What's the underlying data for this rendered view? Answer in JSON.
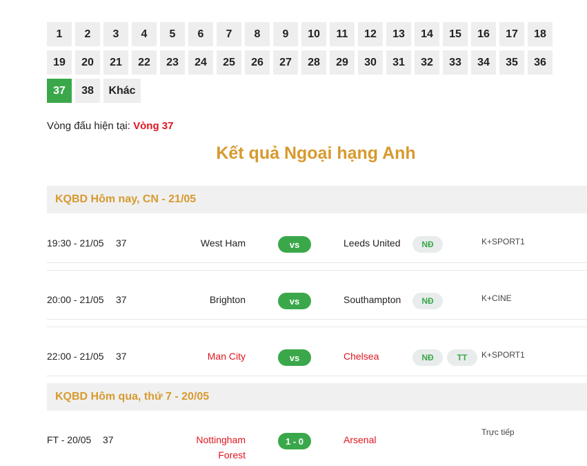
{
  "rounds": [
    "1",
    "2",
    "3",
    "4",
    "5",
    "6",
    "7",
    "8",
    "9",
    "10",
    "11",
    "12",
    "13",
    "14",
    "15",
    "16",
    "17",
    "18",
    "19",
    "20",
    "21",
    "22",
    "23",
    "24",
    "25",
    "26",
    "27",
    "28",
    "29",
    "30",
    "31",
    "32",
    "33",
    "34",
    "35",
    "36",
    "37",
    "38"
  ],
  "active_round": "37",
  "other_label": "Khác",
  "current_round": {
    "label": "Vòng đấu hiện tại:",
    "value": "Vòng 37"
  },
  "title": "Kết quả Ngoại hạng Anh",
  "sections": [
    {
      "header": "KQBD Hôm nay, CN - 21/05",
      "matches": [
        {
          "time": "19:30 - 21/05",
          "round": "37",
          "home": "West Ham",
          "score": "vs",
          "away": "Leeds United",
          "chips": [
            "NĐ"
          ],
          "channel": "K+SPORT1"
        },
        {
          "time": "20:00 - 21/05",
          "round": "37",
          "home": "Brighton",
          "score": "vs",
          "away": "Southampton",
          "chips": [
            "NĐ"
          ],
          "channel": "K+CINE"
        },
        {
          "time": "22:00 - 21/05",
          "round": "37",
          "home": "Man City",
          "score": "vs",
          "away": "Chelsea",
          "chips": [
            "NĐ",
            "TT"
          ],
          "channel": "K+SPORT1"
        }
      ]
    },
    {
      "header": "KQBD Hôm qua, thứ 7 - 20/05",
      "matches": [
        {
          "time": "FT - 20/05",
          "round": "37",
          "home_line1": "Nottingham",
          "home_line2": "Forest",
          "score": "1 - 0",
          "away": "Arsenal",
          "channel": "Trực tiếp"
        }
      ]
    }
  ],
  "colors": {
    "accent_green": "#3aa84a",
    "title_gold": "#d79a2e",
    "highlight_red": "#e0141e",
    "section_bg": "#f0f0f0"
  }
}
